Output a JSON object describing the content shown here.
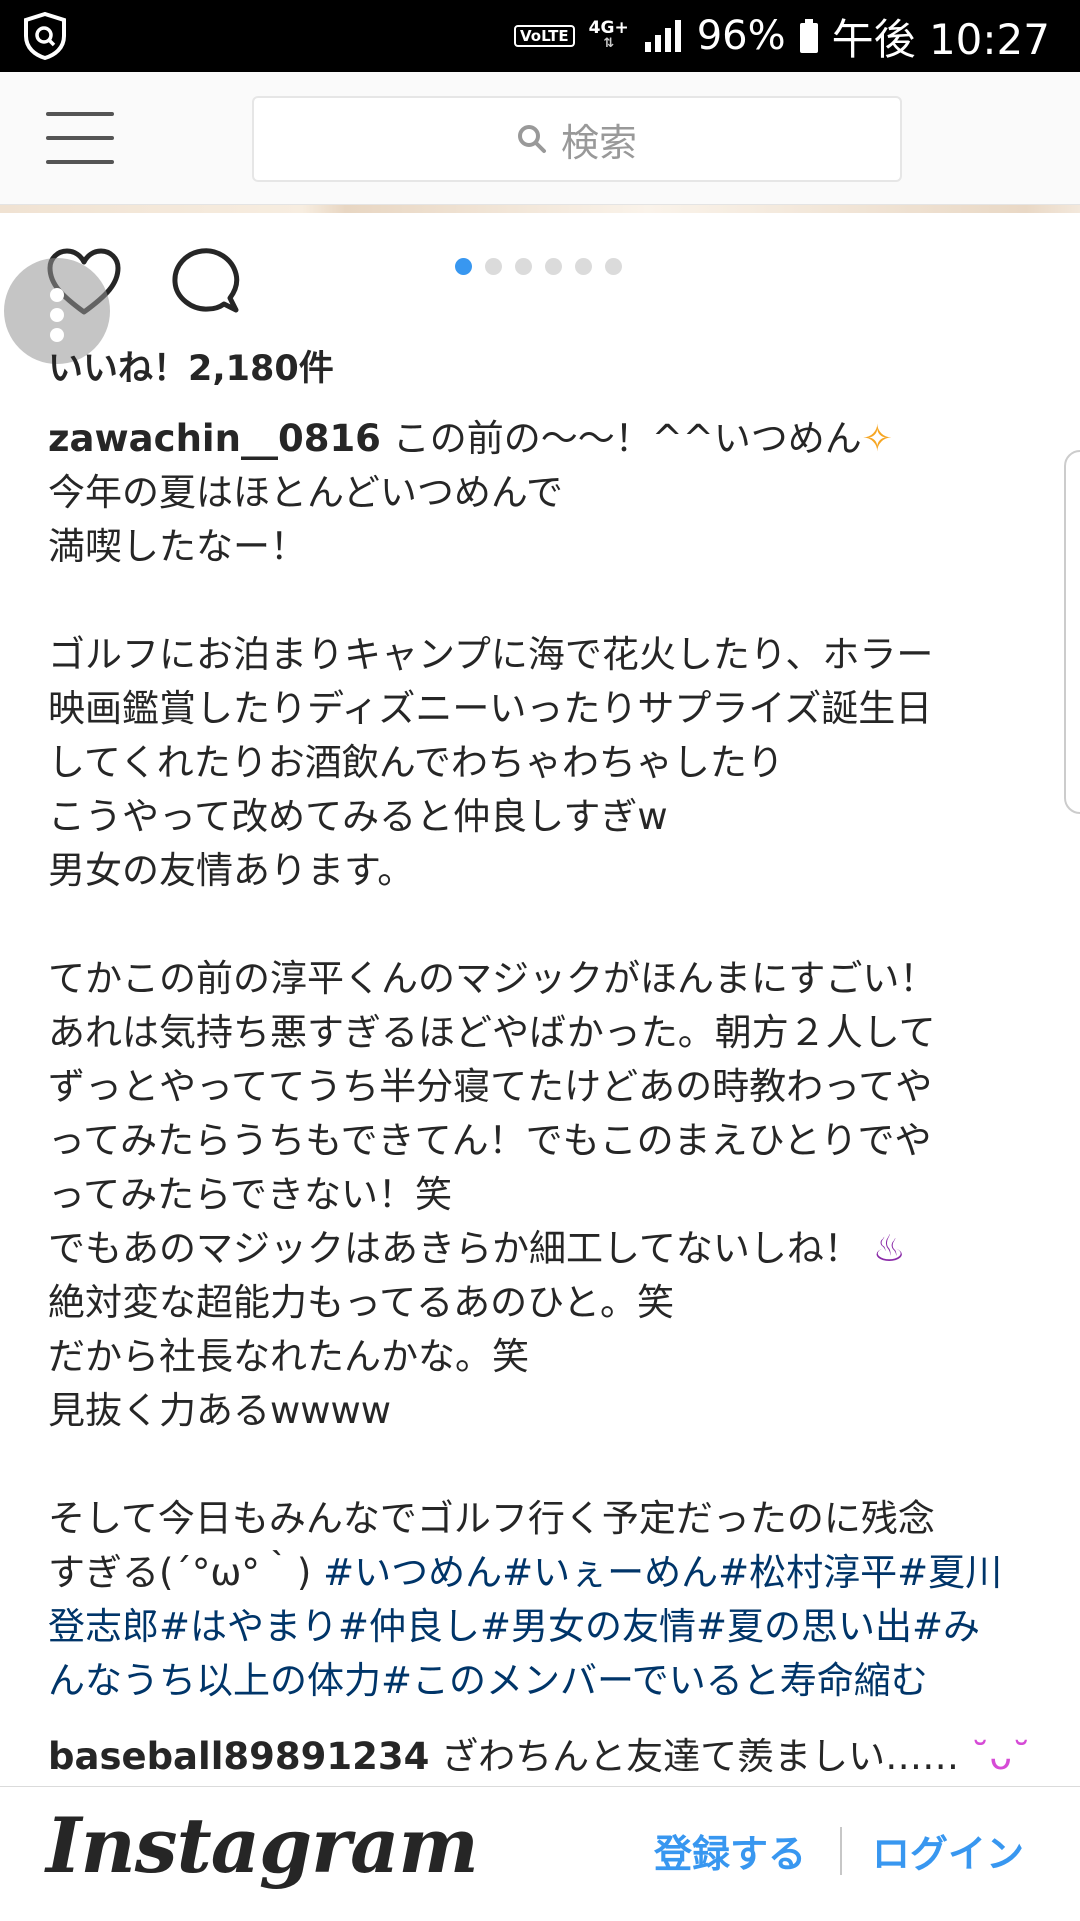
{
  "status_bar": {
    "volte": "VoLTE",
    "network": "4G+",
    "battery_percent": "96%",
    "time": "午後 10:27"
  },
  "header": {
    "search_placeholder": "検索"
  },
  "carousel": {
    "count": 6,
    "active_index": 0
  },
  "post": {
    "likes": "いいね！2,180件",
    "username": "zawachin__0816",
    "caption_text": " この前の〜〜！^^いつめん",
    "caption_rest": "今年の夏はほとんどいつめんで\n満喫したなー！\n\nゴルフにお泊まりキャンプに海で花火したり、ホラー\n映画鑑賞したりディズニーいったりサプライズ誕生日\nしてくれたりお酒飲んでわちゃわちゃしたり\nこうやって改めてみると仲良しすぎw\n男女の友情あります。\n\nてかこの前の淳平くんのマジックがほんまにすごい！\nあれは気持ち悪すぎるほどやばかった。朝方２人して\nずっとやっててうち半分寝てたけどあの時教わってや\nってみたらうちもできてん！でもこのまえひとりでや\nってみたらできない！笑\nでもあのマジックはあきらか細工してないしね！",
    "caption_rest2": "\n絶対変な超能力もってるあのひと。笑\nだから社長なれたんかな。笑\n見抜く力あるwwww\n\nそして今日もみんなでゴルフ行く予定だったのに残念\nすぎる(´°ω°｀) ",
    "hashtags": "#いつめん#いぇーめん#松村淳平#夏川\n登志郎#はやまり#仲良し#男女の友情#夏の思い出#み\nんなうち以上の体力#このメンバーでいると寿命縮む"
  },
  "comment": {
    "username": "baseball89891234",
    "text": " ざわちんと友達て羨ましい……"
  },
  "footer": {
    "logo": "Instagram",
    "signup": "登録する",
    "login": "ログイン"
  },
  "colors": {
    "accent": "#3897f0",
    "hashtag": "#003569"
  },
  "icons": [
    "shield-icon",
    "signal-icon",
    "battery-icon",
    "menu-icon",
    "search-icon",
    "heart-icon",
    "comment-icon",
    "sparkle-icon"
  ]
}
